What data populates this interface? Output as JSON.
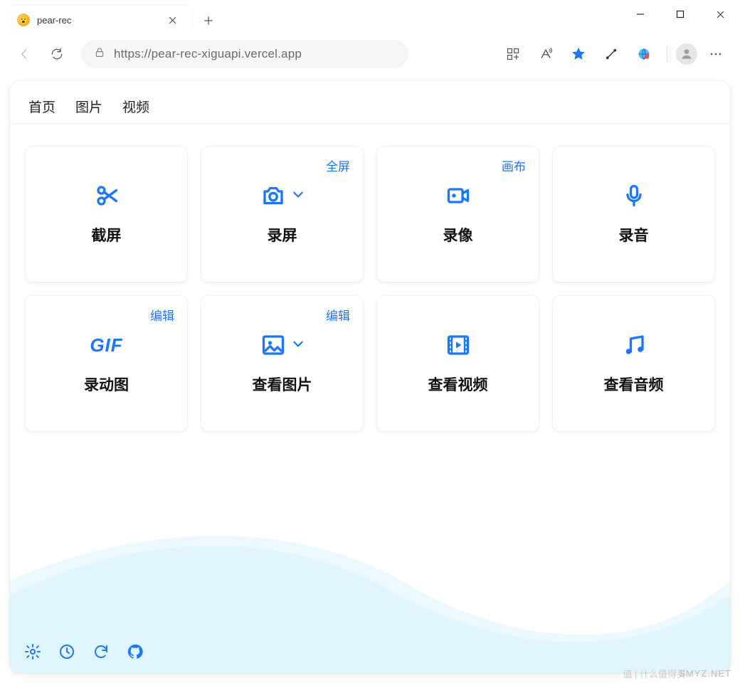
{
  "browser": {
    "tab_title": "pear-rec",
    "url": "https://pear-rec-xiguapi.vercel.app"
  },
  "nav": {
    "items": [
      "首页",
      "图片",
      "视频"
    ]
  },
  "cards": [
    {
      "label": "截屏",
      "badge": "",
      "icon": "scissors"
    },
    {
      "label": "录屏",
      "badge": "全屏",
      "icon": "camera",
      "dropdown": true
    },
    {
      "label": "录像",
      "badge": "画布",
      "icon": "video"
    },
    {
      "label": "录音",
      "badge": "",
      "icon": "mic"
    },
    {
      "label": "录动图",
      "badge": "编辑",
      "icon": "gif"
    },
    {
      "label": "查看图片",
      "badge": "编辑",
      "icon": "image",
      "dropdown": true
    },
    {
      "label": "查看视频",
      "badge": "",
      "icon": "filmplay"
    },
    {
      "label": "查看音频",
      "badge": "",
      "icon": "music"
    }
  ],
  "footer_icons": [
    "settings",
    "history",
    "refresh",
    "github"
  ],
  "colors": {
    "accent": "#1976ff",
    "wave": "#7ed6ff"
  },
  "watermark": "SMYZ.NET",
  "watermark2": "值 | 什么值得买"
}
